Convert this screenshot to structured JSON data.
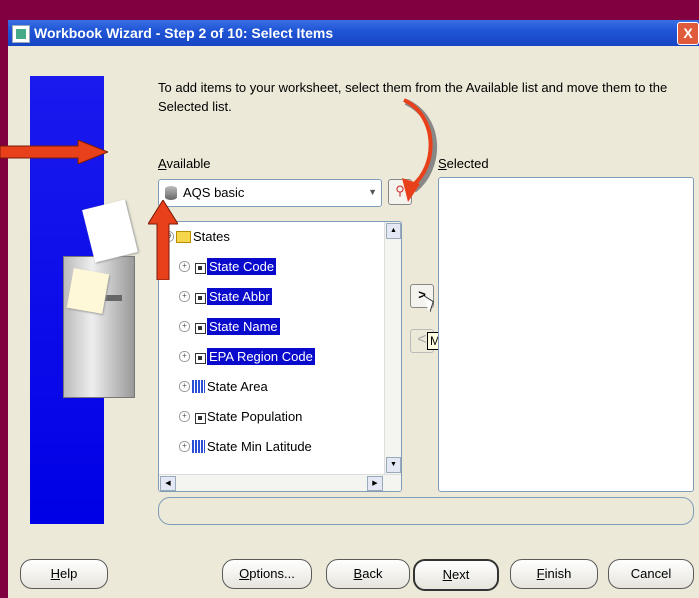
{
  "window": {
    "title": "Workbook Wizard - Step 2 of 10: Select Items",
    "close_glyph": "X"
  },
  "intro_text": "To add items to your worksheet, select them from the Available list and move them to the Selected list.",
  "available": {
    "label_mnemonic": "A",
    "label_rest": "vailable",
    "dropdown_value": "AQS basic"
  },
  "selected": {
    "label_mnemonic": "S",
    "label_rest": "elected"
  },
  "tree": {
    "root": {
      "label": "States",
      "expander": "⊖"
    },
    "items": [
      {
        "label": "State Code",
        "highlighted": true,
        "icon": "item-icon"
      },
      {
        "label": "State Abbr",
        "highlighted": true,
        "icon": "item-icon"
      },
      {
        "label": "State Name",
        "highlighted": true,
        "icon": "item-icon"
      },
      {
        "label": "EPA Region Code",
        "highlighted": true,
        "icon": "item-icon"
      },
      {
        "label": "State Area",
        "highlighted": false,
        "icon": "grid-icon"
      },
      {
        "label": "State Population",
        "highlighted": false,
        "icon": "item-icon"
      },
      {
        "label": "State Min Latitude",
        "highlighted": false,
        "icon": "grid-icon"
      }
    ]
  },
  "move_button": {
    "glyph": ">",
    "tooltip": "Move"
  },
  "remove_button": {
    "glyph": "<"
  },
  "buttons": {
    "help": {
      "mnemonic": "H",
      "rest": "elp"
    },
    "options": {
      "mnemonic": "O",
      "rest": "ptions..."
    },
    "back": {
      "mnemonic": "B",
      "rest": "ack"
    },
    "next": {
      "mnemonic": "N",
      "rest": "ext"
    },
    "finish": {
      "mnemonic": "F",
      "rest": "inish"
    },
    "cancel": {
      "label": "Cancel"
    }
  },
  "colors": {
    "titlebar": "#1f55d6",
    "selection": "#0a0acc",
    "annotation_arrow": "#e8401a",
    "banner": "#0000e6"
  }
}
